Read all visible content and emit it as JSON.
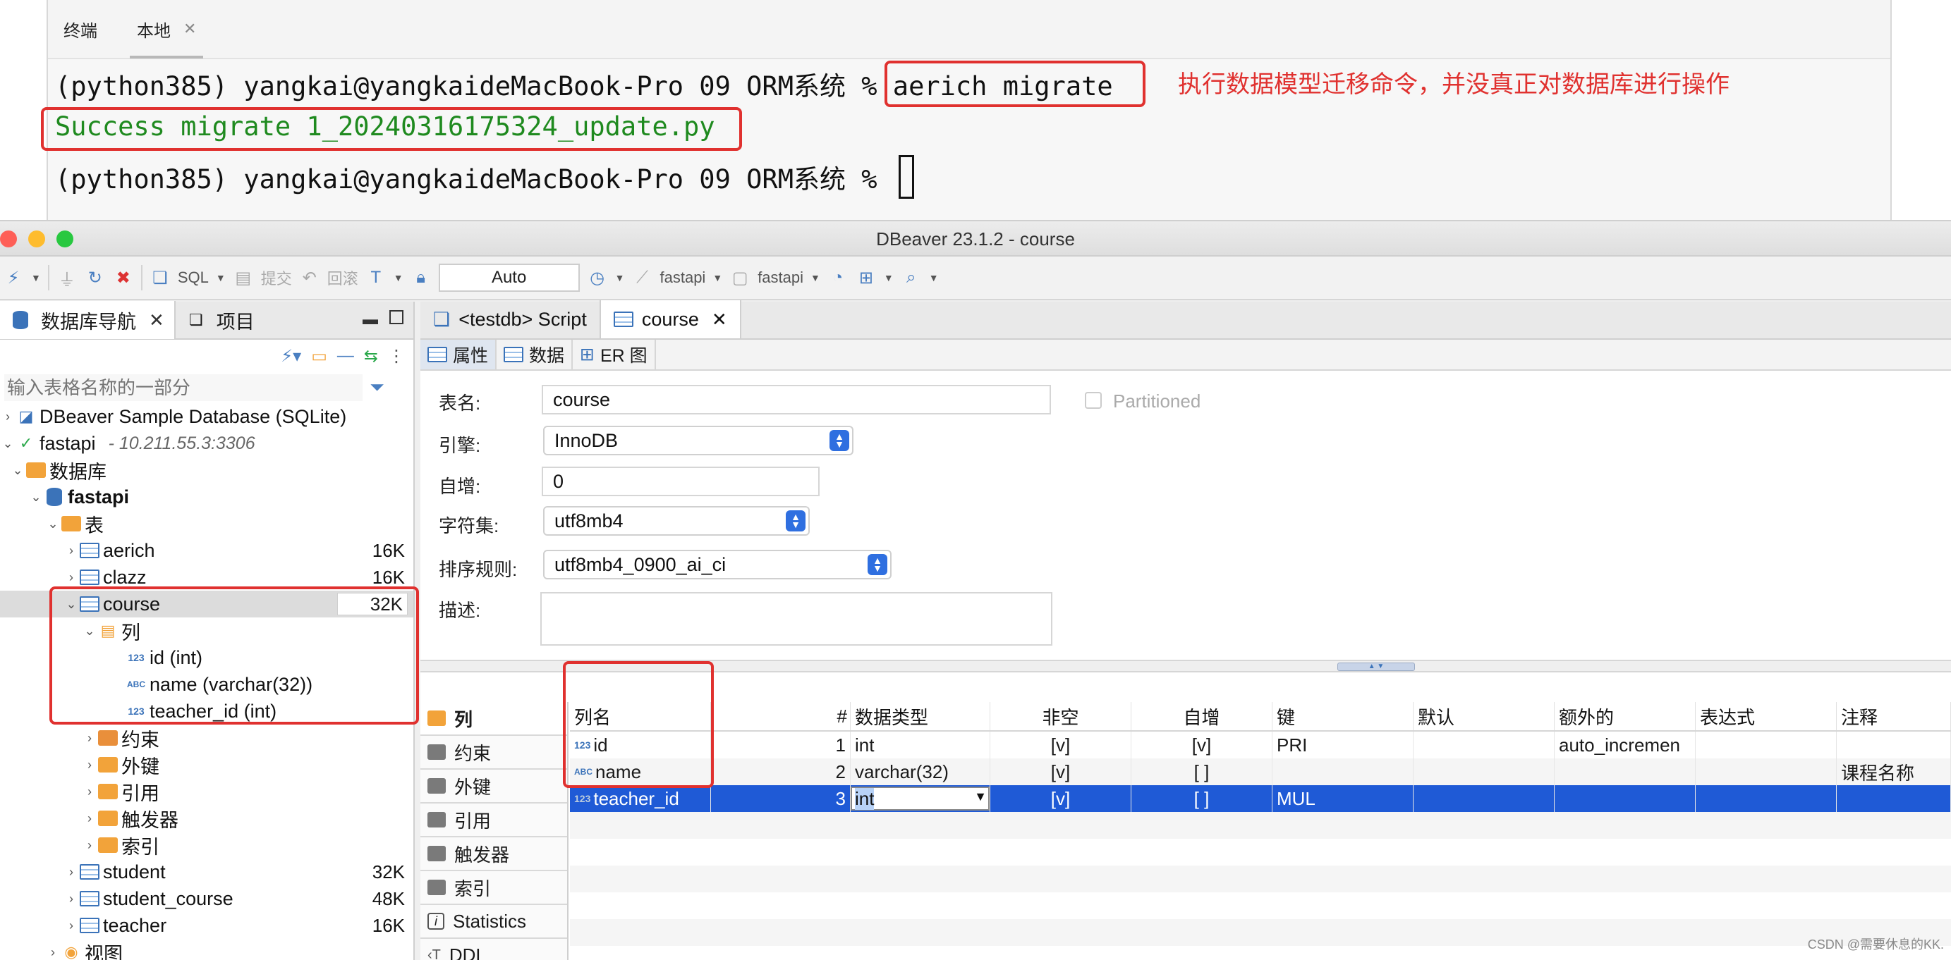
{
  "terminal": {
    "tabs": [
      {
        "label": "终端"
      },
      {
        "label": "本地"
      }
    ],
    "lines": [
      {
        "prompt": "(python385) yangkai@yangkaideMacBook-Pro 09 ORM系统 % ",
        "command": "aerich migrate"
      },
      {
        "output": "Success migrate 1_20240316175324_update.py"
      },
      {
        "prompt": "(python385) yangkai@yangkaideMacBook-Pro 09 ORM系统 % "
      }
    ],
    "annotation": "执行数据模型迁移命令，并没真正对数据库进行操作"
  },
  "window": {
    "title": "DBeaver 23.1.2 - course"
  },
  "toolbar": {
    "sql": "SQL",
    "commit": "提交",
    "rollback": "回滚",
    "auto": "Auto",
    "conn1": "fastapi",
    "conn2": "fastapi"
  },
  "navigator": {
    "tabs": [
      {
        "label": "数据库导航"
      },
      {
        "label": "项目"
      }
    ],
    "filter_placeholder": "输入表格名称的一部分",
    "tree": [
      {
        "label": "DBeaver Sample Database (SQLite)"
      },
      {
        "label": "fastapi",
        "sub": "- 10.211.55.3:3306"
      },
      {
        "label": "数据库"
      },
      {
        "label": "fastapi"
      },
      {
        "label": "表"
      },
      {
        "label": "aerich",
        "size": "16K"
      },
      {
        "label": "clazz",
        "size": "16K"
      },
      {
        "label": "course",
        "size": "32K"
      },
      {
        "label": "列"
      },
      {
        "label": "id (int)"
      },
      {
        "label": "name (varchar(32))"
      },
      {
        "label": "teacher_id (int)"
      },
      {
        "label": "约束"
      },
      {
        "label": "外键"
      },
      {
        "label": "引用"
      },
      {
        "label": "触发器"
      },
      {
        "label": "索引"
      },
      {
        "label": "student",
        "size": "32K"
      },
      {
        "label": "student_course",
        "size": "48K"
      },
      {
        "label": "teacher",
        "size": "16K"
      },
      {
        "label": "视图"
      }
    ]
  },
  "editor": {
    "tabs": [
      {
        "label": "<testdb> Script"
      },
      {
        "label": "course"
      }
    ],
    "subtabs": [
      {
        "label": "属性"
      },
      {
        "label": "数据"
      },
      {
        "label": "ER 图"
      }
    ],
    "props": {
      "table_name_label": "表名:",
      "table_name": "course",
      "engine_label": "引擎:",
      "engine": "InnoDB",
      "auto_inc_label": "自增:",
      "auto_inc": "0",
      "charset_label": "字符集:",
      "charset": "utf8mb4",
      "collation_label": "排序规则:",
      "collation": "utf8mb4_0900_ai_ci",
      "desc_label": "描述:",
      "partitioned": "Partitioned"
    },
    "side": [
      {
        "label": "列"
      },
      {
        "label": "约束"
      },
      {
        "label": "外键"
      },
      {
        "label": "引用"
      },
      {
        "label": "触发器"
      },
      {
        "label": "索引"
      },
      {
        "label": "Statistics"
      },
      {
        "label": "DDL"
      }
    ],
    "columns_header": [
      "列名",
      "#",
      "数据类型",
      "非空",
      "自增",
      "键",
      "默认",
      "额外的",
      "表达式",
      "注释"
    ],
    "rows": [
      {
        "name": "id",
        "num": "1",
        "type": "int",
        "notnull": "[v]",
        "autoinc": "[v]",
        "key": "PRI",
        "default": "",
        "extra": "auto_incremen",
        "expr": "",
        "comment": ""
      },
      {
        "name": "name",
        "num": "2",
        "type": "varchar(32)",
        "notnull": "[v]",
        "autoinc": "[ ]",
        "key": "",
        "default": "",
        "extra": "",
        "expr": "",
        "comment": "课程名称"
      },
      {
        "name": "teacher_id",
        "num": "3",
        "type": "int",
        "notnull": "[v]",
        "autoinc": "[ ]",
        "key": "MUL",
        "default": "",
        "extra": "",
        "expr": "",
        "comment": ""
      }
    ]
  },
  "watermark": "CSDN @需要休息的KK."
}
